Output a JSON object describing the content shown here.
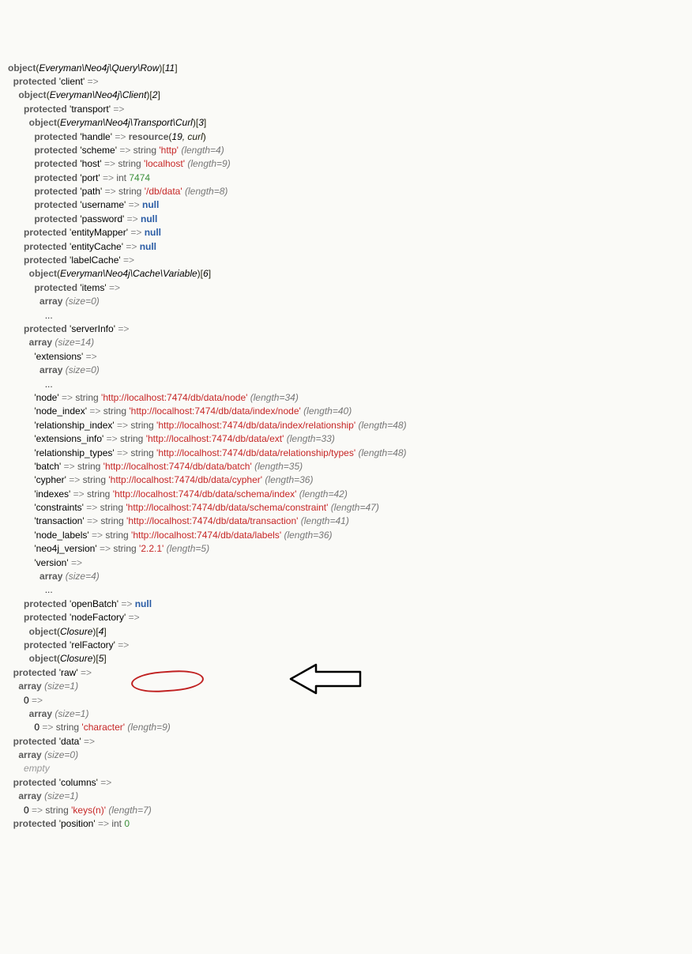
{
  "root": {
    "class": "Everyman\\Neo4j\\Query\\Row",
    "id": 11
  },
  "client": {
    "class": "Everyman\\Neo4j\\Client",
    "id": 2,
    "transport": {
      "class": "Everyman\\Neo4j\\Transport\\Curl",
      "id": 3,
      "handle": {
        "type": "resource",
        "rid": 19,
        "rtype": "curl"
      },
      "scheme": {
        "val": "http",
        "len": 4
      },
      "host": {
        "val": "localhost",
        "len": 9
      },
      "port": 7474,
      "path": {
        "val": "/db/data",
        "len": 8
      },
      "username": "null",
      "password": "null"
    },
    "entityMapper": "null",
    "entityCache": "null",
    "labelCache": {
      "class": "Everyman\\Neo4j\\Cache\\Variable",
      "id": 6,
      "items_size": 0
    },
    "serverInfo": {
      "size": 14,
      "extensions_size": 0,
      "node": {
        "val": "http://localhost:7474/db/data/node",
        "len": 34
      },
      "node_index": {
        "val": "http://localhost:7474/db/data/index/node",
        "len": 40
      },
      "relationship_index": {
        "val": "http://localhost:7474/db/data/index/relationship",
        "len": 48
      },
      "extensions_info": {
        "val": "http://localhost:7474/db/data/ext",
        "len": 33
      },
      "relationship_types": {
        "val": "http://localhost:7474/db/data/relationship/types",
        "len": 48
      },
      "batch": {
        "val": "http://localhost:7474/db/data/batch",
        "len": 35
      },
      "cypher": {
        "val": "http://localhost:7474/db/data/cypher",
        "len": 36
      },
      "indexes": {
        "val": "http://localhost:7474/db/data/schema/index",
        "len": 42
      },
      "constraints": {
        "val": "http://localhost:7474/db/data/schema/constraint",
        "len": 47
      },
      "transaction": {
        "val": "http://localhost:7474/db/data/transaction",
        "len": 41
      },
      "node_labels": {
        "val": "http://localhost:7474/db/data/labels",
        "len": 36
      },
      "neo4j_version": {
        "val": "2.2.1",
        "len": 5
      },
      "version_size": 4
    },
    "openBatch": "null",
    "nodeFactory": {
      "class": "Closure",
      "id": 4
    },
    "relFactory": {
      "class": "Closure",
      "id": 5
    }
  },
  "raw": {
    "size": 1,
    "inner_size": 1,
    "character": {
      "val": "character",
      "len": 9
    }
  },
  "data": {
    "size": 0,
    "empty": "empty"
  },
  "columns": {
    "size": 1,
    "keysn": {
      "val": "keys(n)",
      "len": 7
    }
  },
  "position": 0,
  "labels": {
    "object": "object",
    "protected": "protected",
    "array": "array",
    "size_eq": "size=",
    "resource": "resource",
    "string": "string",
    "int": "int",
    "length_eq": "length=",
    "arrow": "=>"
  },
  "keys": {
    "client": "client",
    "transport": "transport",
    "handle": "handle",
    "scheme": "scheme",
    "host": "host",
    "port": "port",
    "path": "path",
    "username": "username",
    "password": "password",
    "entityMapper": "entityMapper",
    "entityCache": "entityCache",
    "labelCache": "labelCache",
    "items": "items",
    "serverInfo": "serverInfo",
    "extensions": "extensions",
    "node": "node",
    "node_index": "node_index",
    "relationship_index": "relationship_index",
    "extensions_info": "extensions_info",
    "relationship_types": "relationship_types",
    "batch": "batch",
    "cypher": "cypher",
    "indexes": "indexes",
    "constraints": "constraints",
    "transaction": "transaction",
    "node_labels": "node_labels",
    "neo4j_version": "neo4j_version",
    "version": "version",
    "openBatch": "openBatch",
    "nodeFactory": "nodeFactory",
    "relFactory": "relFactory",
    "raw": "raw",
    "data": "data",
    "columns": "columns",
    "position": "position"
  }
}
